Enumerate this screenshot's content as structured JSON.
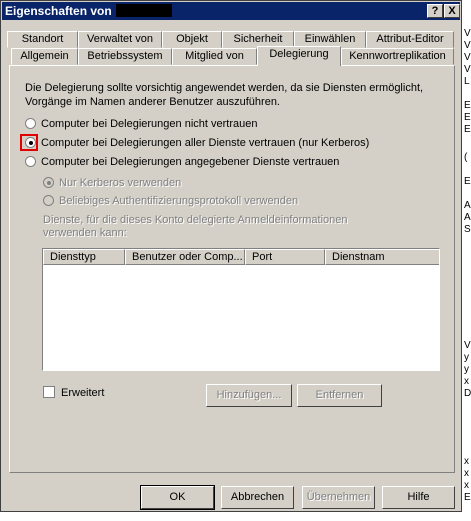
{
  "window": {
    "title": "Eigenschaften von"
  },
  "title_buttons": {
    "help": "?",
    "close": "X"
  },
  "tabs_row1": [
    "Standort",
    "Verwaltet von",
    "Objekt",
    "Sicherheit",
    "Einwählen",
    "Attribut-Editor"
  ],
  "tabs_row2": [
    "Allgemein",
    "Betriebssystem",
    "Mitglied von",
    "Delegierung",
    "Kennwortreplikation"
  ],
  "delegation": {
    "description": "Die Delegierung sollte vorsichtig angewendet werden, da sie Diensten ermöglicht, Vorgänge im Namen anderer Benutzer auszuführen.",
    "options": [
      "Computer bei Delegierungen nicht vertrauen",
      "Computer bei Delegierungen aller Dienste vertrauen (nur Kerberos)",
      "Computer bei Delegierungen angegebener Dienste vertrauen"
    ],
    "sub_options": [
      "Nur Kerberos verwenden",
      "Beliebiges Authentifizierungsprotokoll verwenden"
    ],
    "services_label": "Dienste, für die dieses Konto delegierte Anmeldeinformationen verwenden kann:",
    "columns": [
      "Diensttyp",
      "Benutzer oder Comp...",
      "Port",
      "Dienstnam"
    ],
    "extended_label": "Erweitert",
    "add_button": "Hinzufügen...",
    "remove_button": "Entfernen"
  },
  "footer": {
    "ok": "OK",
    "cancel": "Abbrechen",
    "apply": "Übernehmen",
    "help": "Hilfe"
  }
}
